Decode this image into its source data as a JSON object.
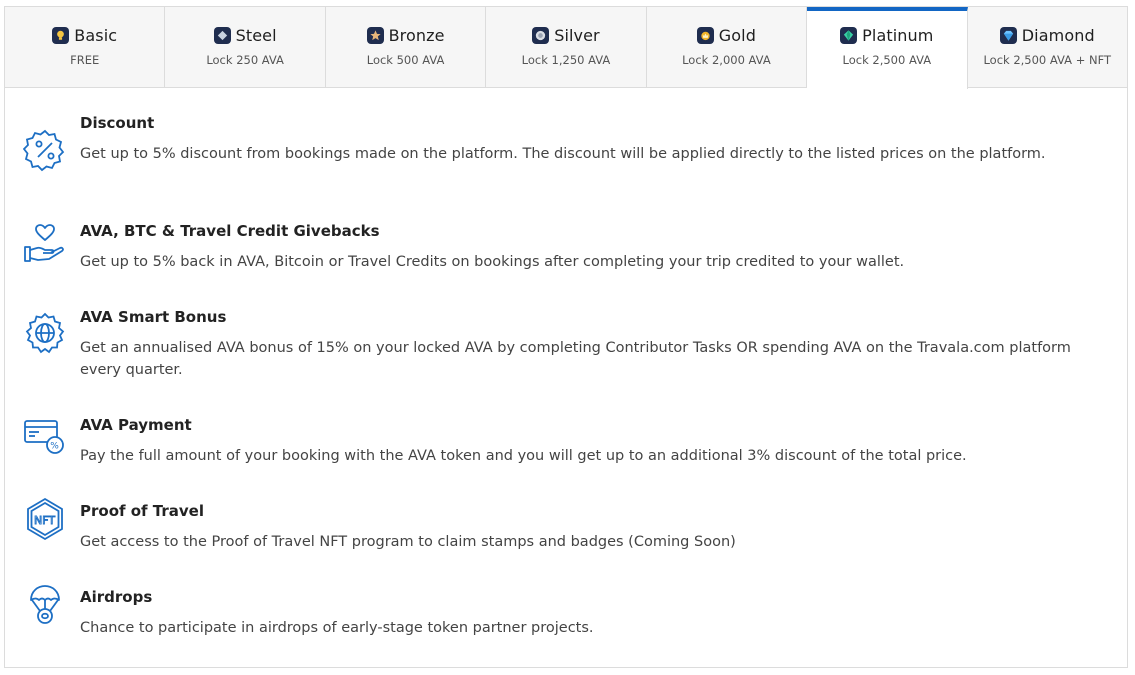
{
  "tabs": [
    {
      "name": "Basic",
      "sub": "FREE",
      "icon": "lightbulb-icon",
      "icon_color": "#f4c542"
    },
    {
      "name": "Steel",
      "sub": "Lock 250 AVA",
      "icon": "steel-gem-icon",
      "icon_color": "#c8d2e0"
    },
    {
      "name": "Bronze",
      "sub": "Lock 500 AVA",
      "icon": "star-icon",
      "icon_color": "#e8b77b"
    },
    {
      "name": "Silver",
      "sub": "Lock 1,250 AVA",
      "icon": "silver-medal-icon",
      "icon_color": "#d9dde4"
    },
    {
      "name": "Gold",
      "sub": "Lock 2,000 AVA",
      "icon": "gold-crown-icon",
      "icon_color": "#f0b429"
    },
    {
      "name": "Platinum",
      "sub": "Lock 2,500 AVA",
      "icon": "emerald-gem-icon",
      "icon_color": "#3ad1a6"
    },
    {
      "name": "Diamond",
      "sub": "Lock 2,500 AVA + NFT",
      "icon": "diamond-icon",
      "icon_color": "#6ec3ff"
    }
  ],
  "active_tab": "Platinum",
  "accent_color": "#1266c4",
  "features": [
    {
      "title": "Discount",
      "desc": "Get up to 5% discount from bookings made on the platform. The discount will be applied directly to the listed prices on the platform.",
      "icon": "percent-badge-icon"
    },
    {
      "title": "AVA, BTC & Travel Credit Givebacks",
      "desc": "Get up to 5% back in AVA, Bitcoin or Travel Credits on bookings after completing your trip credited to your wallet.",
      "icon": "heart-hand-icon"
    },
    {
      "title": "AVA Smart Bonus",
      "desc": "Get an annualised AVA bonus of 15% on your locked AVA by completing Contributor Tasks OR spending AVA on the Travala.com platform every quarter.",
      "icon": "globe-gear-icon"
    },
    {
      "title": "AVA Payment",
      "desc": "Pay the full amount of your booking with the AVA token and you will get up to an additional 3% discount of the total price.",
      "icon": "card-percent-icon"
    },
    {
      "title": "Proof of Travel",
      "desc": "Get access to the Proof of Travel NFT program to claim stamps and badges (Coming Soon)",
      "icon": "nft-hexagon-icon"
    },
    {
      "title": "Airdrops",
      "desc": "Chance to participate in airdrops of early-stage token partner projects.",
      "icon": "parachute-icon"
    }
  ]
}
